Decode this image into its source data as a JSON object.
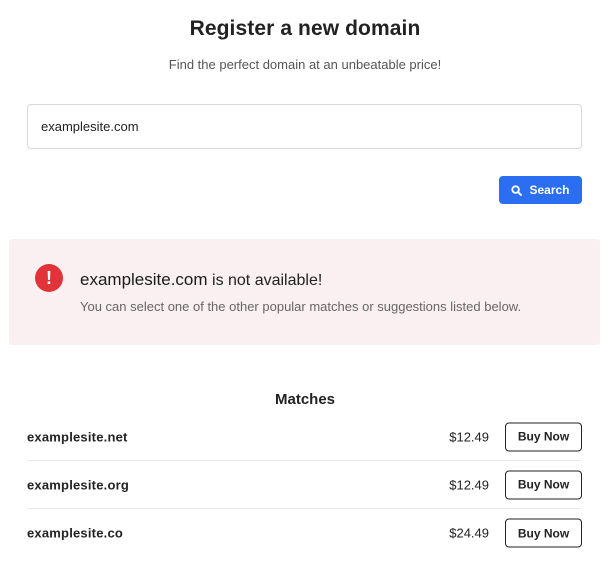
{
  "header": {
    "title": "Register a new domain",
    "subtitle": "Find the perfect domain at an unbeatable price!"
  },
  "search": {
    "value": "examplesite.com",
    "button_label": "Search",
    "button_icon": "search-icon",
    "button_color": "#2b6ef2"
  },
  "alert": {
    "icon": "exclamation-icon",
    "icon_symbol": "!",
    "icon_color": "#e0343a",
    "background": "#fbf0f1",
    "domain": "examplesite.com",
    "status_text": " is not available!",
    "message": "You can select one of the other popular matches or suggestions listed below."
  },
  "matches": {
    "heading": "Matches",
    "items": [
      {
        "domain": "examplesite.net",
        "price": "$12.49",
        "button_label": "Buy Now"
      },
      {
        "domain": "examplesite.org",
        "price": "$12.49",
        "button_label": "Buy Now"
      },
      {
        "domain": "examplesite.co",
        "price": "$24.49",
        "button_label": "Buy Now"
      }
    ]
  }
}
